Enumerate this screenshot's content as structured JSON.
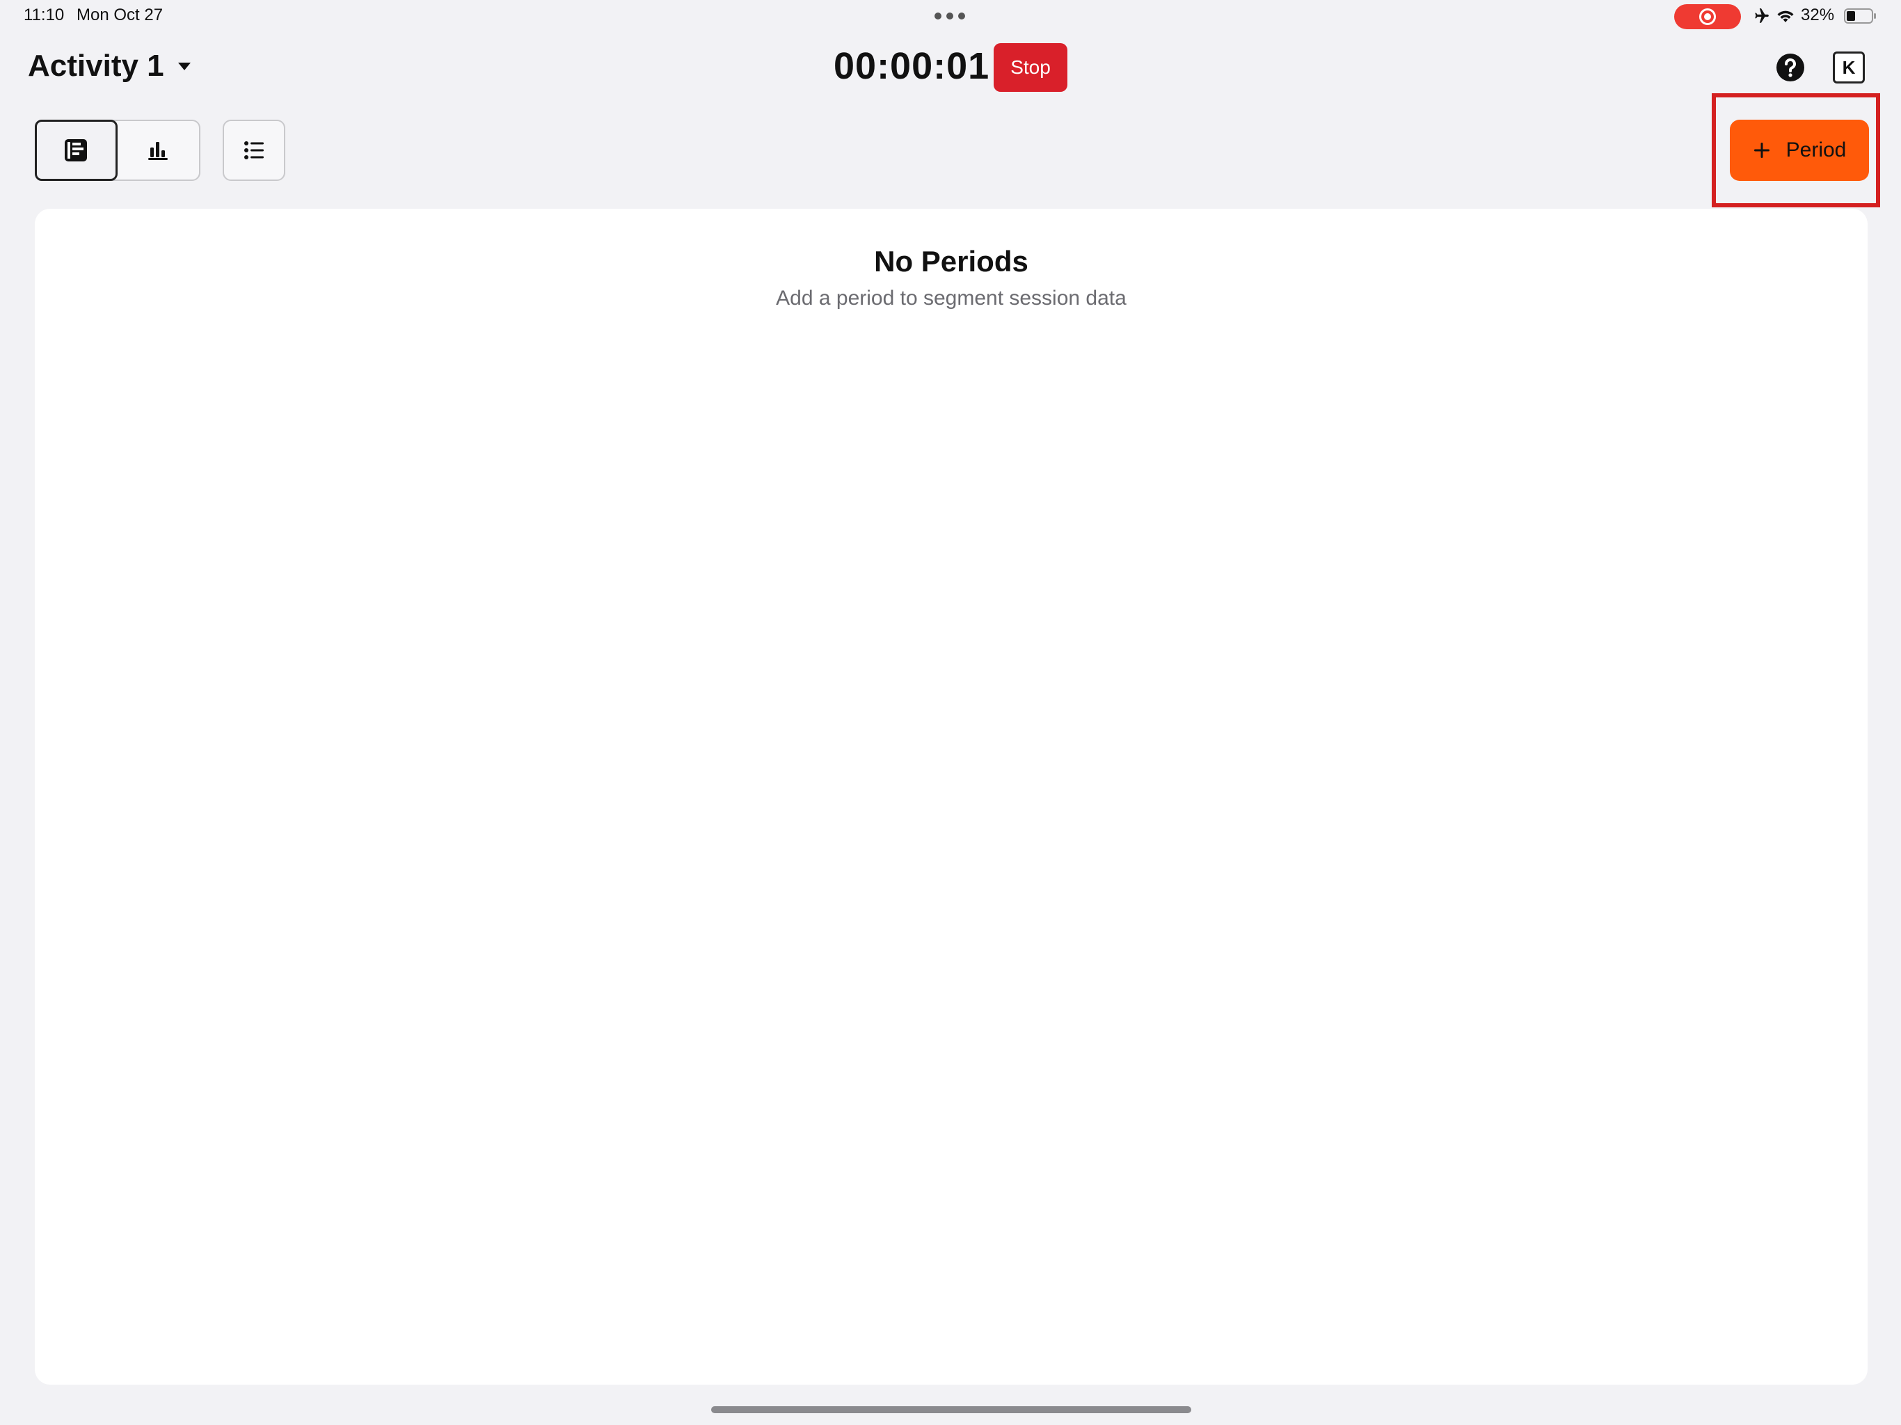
{
  "status_bar": {
    "time": "11:10",
    "date": "Mon Oct 27",
    "battery": "32%",
    "icons": [
      "screen-recording-icon",
      "airplane-icon",
      "wifi-icon",
      "battery-icon"
    ]
  },
  "header": {
    "activity_title": "Activity 1",
    "timer": "00:00:01",
    "stop_label": "Stop",
    "account_initial": "K",
    "help_icon": "question-icon"
  },
  "toolbar": {
    "views": [
      {
        "name": "timeline-view",
        "icon": "timeline-icon",
        "active": true
      },
      {
        "name": "chart-view",
        "icon": "bar-chart-icon",
        "active": false
      }
    ],
    "list_icon": "list-icon",
    "add_period_label": "Period",
    "add_period_icon": "plus-icon"
  },
  "main": {
    "empty_title": "No Periods",
    "empty_subtitle": "Add a period to segment session data"
  },
  "colors": {
    "background": "#f2f2f5",
    "accent": "#ff5a0a",
    "stop": "#d9202a",
    "highlight": "#d42020",
    "recording": "#ef3a32"
  }
}
